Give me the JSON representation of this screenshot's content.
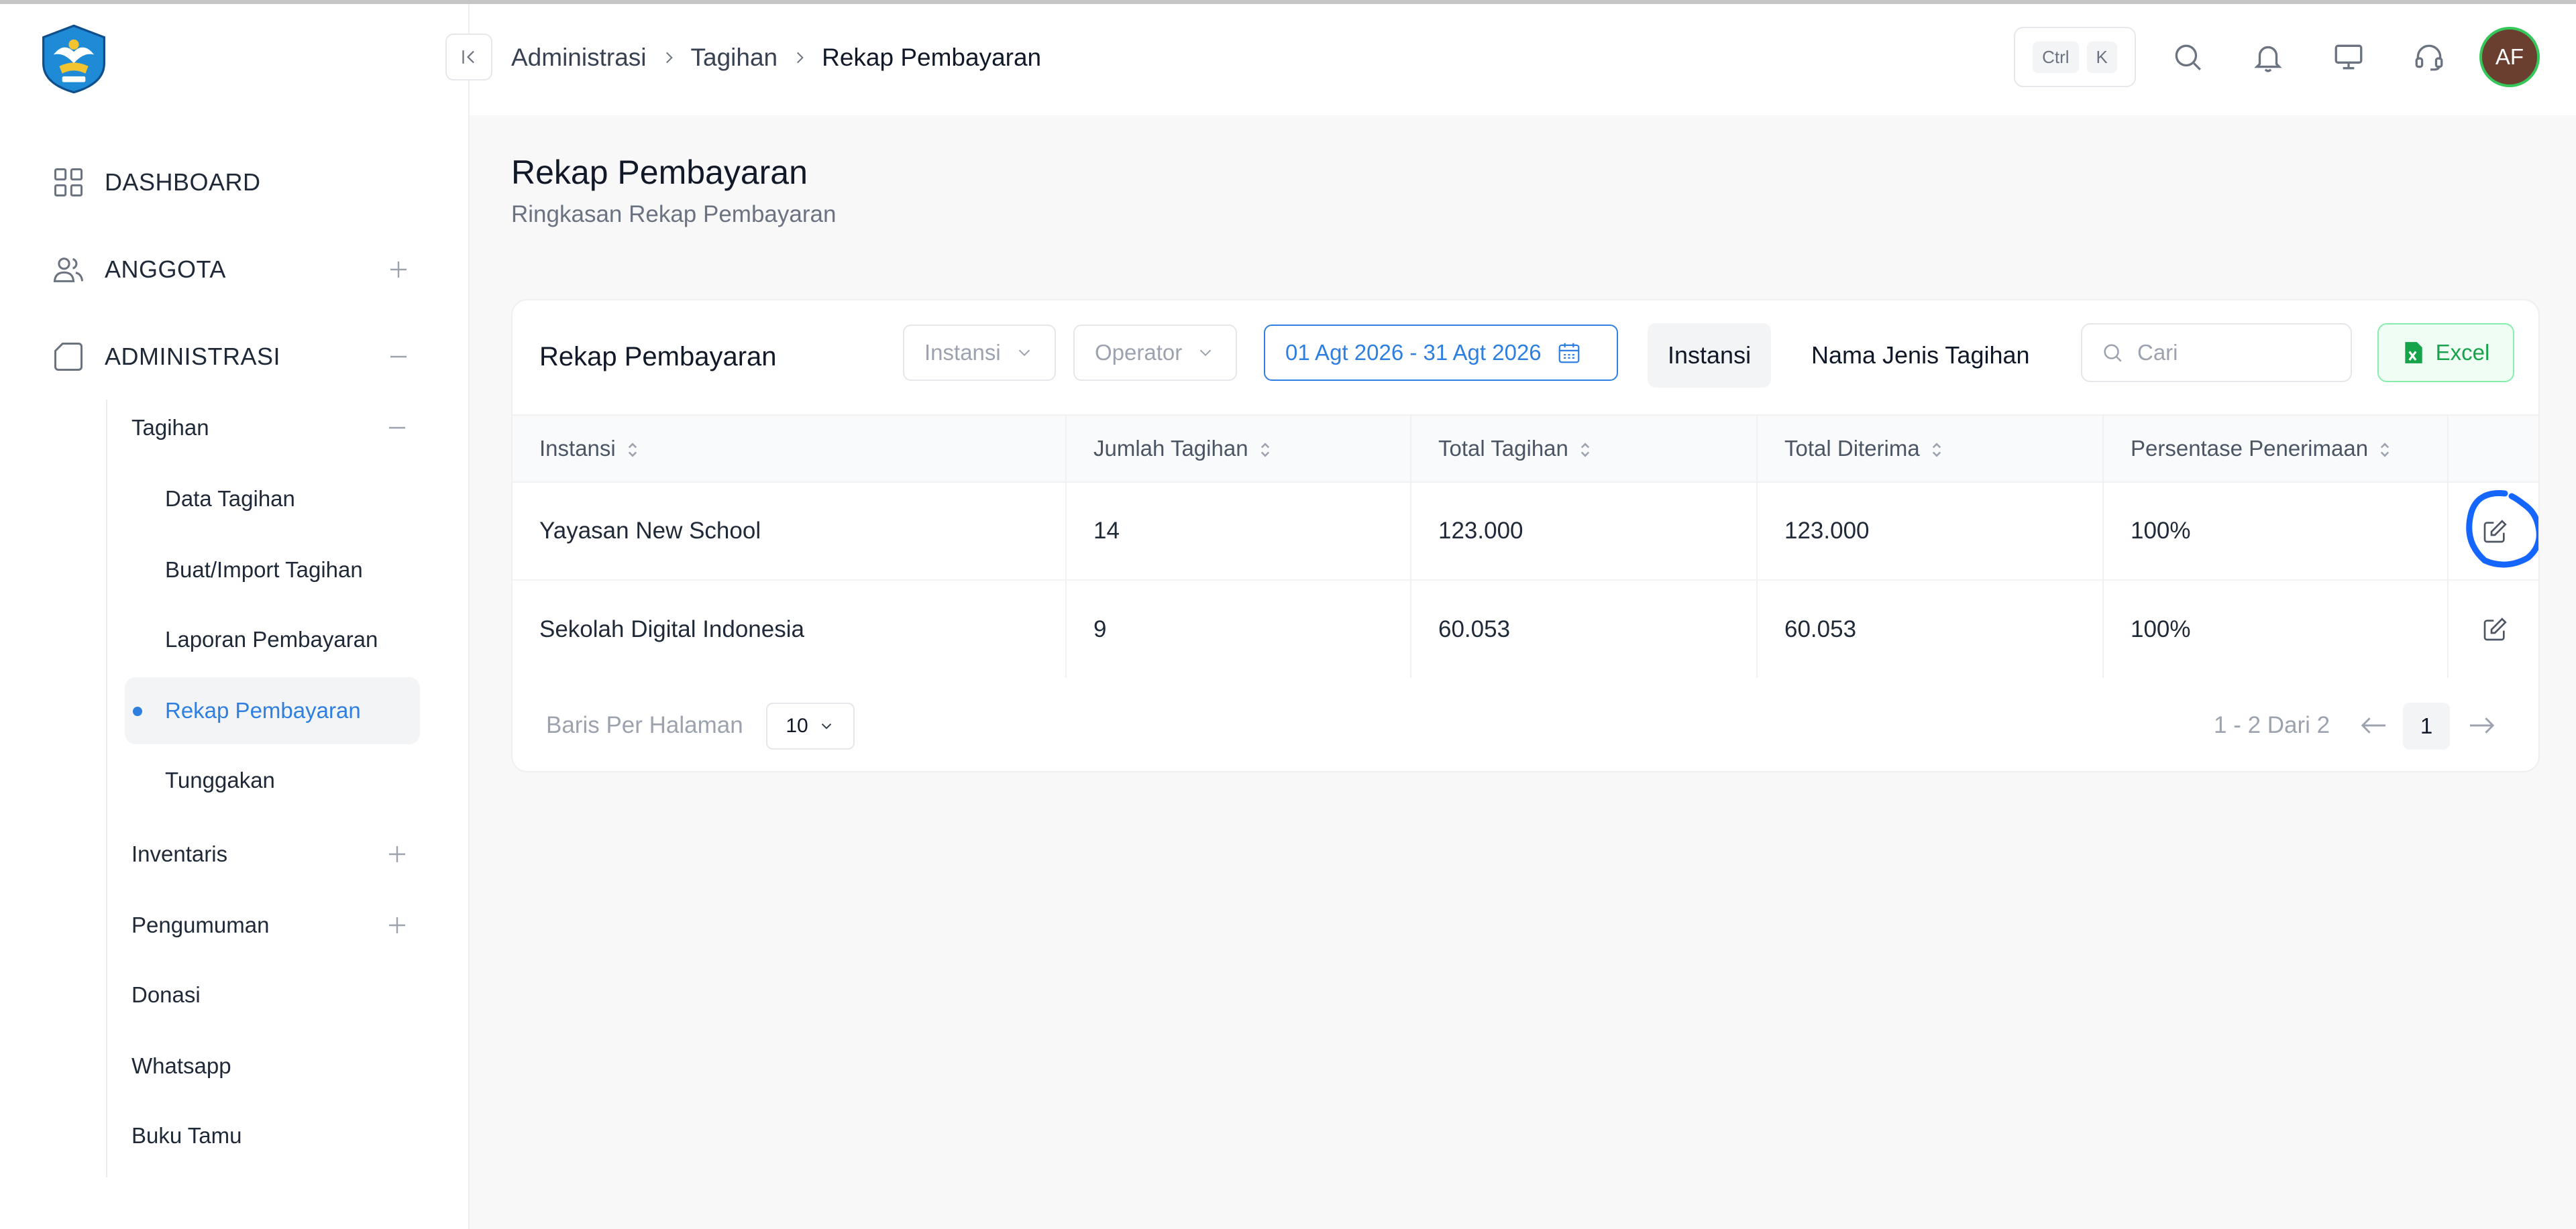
{
  "breadcrumb": [
    "Administrasi",
    "Tagihan",
    "Rekap Pembayaran"
  ],
  "shortcut": {
    "ctrl": "Ctrl",
    "key": "K"
  },
  "user": {
    "initials": "AF"
  },
  "sidebar": {
    "dashboard": "DASHBOARD",
    "anggota": "ANGGOTA",
    "administrasi": "ADMINISTRASI",
    "tagihan": "Tagihan",
    "tagihan_children": [
      "Data Tagihan",
      "Buat/Import Tagihan",
      "Laporan Pembayaran",
      "Rekap Pembayaran",
      "Tunggakan"
    ],
    "inventaris": "Inventaris",
    "pengumuman": "Pengumuman",
    "donasi": "Donasi",
    "whatsapp": "Whatsapp",
    "buku_tamu": "Buku Tamu"
  },
  "page": {
    "title": "Rekap Pembayaran",
    "subtitle": "Ringkasan Rekap Pembayaran"
  },
  "card": {
    "title": "Rekap Pembayaran",
    "filter_instansi": "Instansi",
    "filter_operator": "Operator",
    "date_range": "01 Agt 2026 - 31 Agt 2026",
    "tab_instansi": "Instansi",
    "tab_jenis": "Nama Jenis Tagihan",
    "search_placeholder": "Cari",
    "excel": "Excel"
  },
  "table": {
    "headers": [
      "Instansi",
      "Jumlah Tagihan",
      "Total Tagihan",
      "Total Diterima",
      "Persentase Penerimaan"
    ],
    "rows": [
      [
        "Yayasan New School",
        "14",
        "123.000",
        "123.000",
        "100%"
      ],
      [
        "Sekolah Digital Indonesia",
        "9",
        "60.053",
        "60.053",
        "100%"
      ]
    ]
  },
  "pagination": {
    "rows_label": "Baris Per Halaman",
    "rows_value": "10",
    "info": "1 - 2 Dari 2",
    "current": "1"
  },
  "colors": {
    "accent": "#2f7fe0",
    "excel": "#16a34a",
    "marker": "#1565ff"
  }
}
